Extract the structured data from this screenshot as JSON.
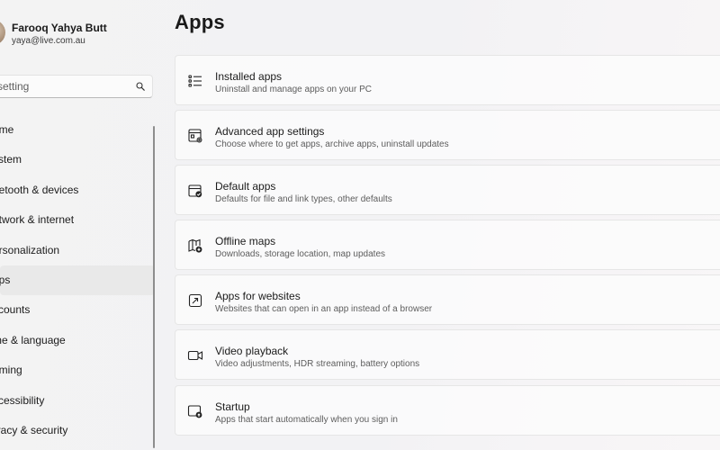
{
  "user": {
    "name": "Farooq Yahya Butt",
    "email": "yaya@live.com.au"
  },
  "search": {
    "placeholder": "setting"
  },
  "nav": [
    {
      "label": "ome",
      "id": "home"
    },
    {
      "label": "ystem",
      "id": "system"
    },
    {
      "label": "uetooth & devices",
      "id": "bluetooth"
    },
    {
      "label": "etwork & internet",
      "id": "network"
    },
    {
      "label": "ersonalization",
      "id": "personalization"
    },
    {
      "label": "ops",
      "id": "apps",
      "selected": true
    },
    {
      "label": "ccounts",
      "id": "accounts"
    },
    {
      "label": "me & language",
      "id": "time-language"
    },
    {
      "label": "aming",
      "id": "gaming"
    },
    {
      "label": "ccessibility",
      "id": "accessibility"
    },
    {
      "label": "ivacy & security",
      "id": "privacy"
    }
  ],
  "page": {
    "title": "Apps"
  },
  "cards": [
    {
      "title": "Installed apps",
      "subtitle": "Uninstall and manage apps on your PC",
      "icon": "list-icon"
    },
    {
      "title": "Advanced app settings",
      "subtitle": "Choose where to get apps, archive apps, uninstall updates",
      "icon": "app-settings-icon"
    },
    {
      "title": "Default apps",
      "subtitle": "Defaults for file and link types, other defaults",
      "icon": "default-apps-icon"
    },
    {
      "title": "Offline maps",
      "subtitle": "Downloads, storage location, map updates",
      "icon": "map-download-icon"
    },
    {
      "title": "Apps for websites",
      "subtitle": "Websites that can open in an app instead of a browser",
      "icon": "open-in-app-icon"
    },
    {
      "title": "Video playback",
      "subtitle": "Video adjustments, HDR streaming, battery options",
      "icon": "video-icon"
    },
    {
      "title": "Startup",
      "subtitle": "Apps that start automatically when you sign in",
      "icon": "startup-icon"
    }
  ],
  "colors": {
    "selected_bg": "#e9e9e9",
    "card_bg": "#fbfbfb",
    "text": "#1b1b1b",
    "subtext": "#5d5d5d"
  }
}
